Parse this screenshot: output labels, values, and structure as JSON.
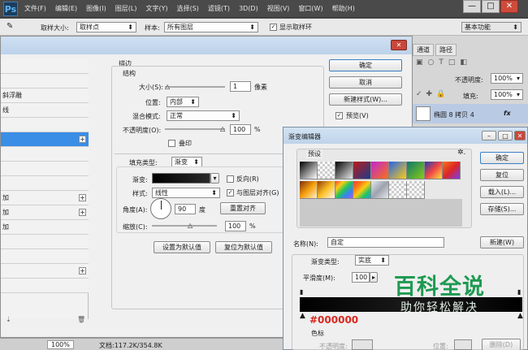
{
  "app": {
    "logo": "Ps"
  },
  "menu": [
    "文件(F)",
    "编辑(E)",
    "图像(I)",
    "图层(L)",
    "文字(Y)",
    "选择(S)",
    "滤镜(T)",
    "3D(D)",
    "视图(V)",
    "窗口(W)",
    "帮助(H)"
  ],
  "window_controls": {
    "minimize": "—",
    "restore": "□",
    "close": "✕"
  },
  "options_bar": {
    "sample_size_label": "取样大小:",
    "sample_size_value": "取样点",
    "sample_label": "样本:",
    "sample_value": "所有图层",
    "show_ring_label": "显示取样环",
    "workspace": "基本功能"
  },
  "layer_style": {
    "title_close": "✕",
    "list_items": [
      "",
      "",
      "斜浮雕",
      "线",
      "",
      "",
      "",
      "",
      "",
      "加",
      "加",
      "加",
      "",
      "",
      "",
      ""
    ],
    "stroke": {
      "section": "描边",
      "structure": "结构",
      "size_label": "大小(S):",
      "size_value": "1",
      "size_unit": "像素",
      "position_label": "位置:",
      "position_value": "内部",
      "blend_label": "混合模式:",
      "blend_value": "正常",
      "opacity_label": "不透明度(O):",
      "opacity_value": "100",
      "opacity_unit": "%",
      "overprint_label": "叠印",
      "fill_type_label": "填充类型:",
      "fill_type_value": "渐变",
      "gradient_label": "渐变:",
      "reverse_label": "反向(R)",
      "style_label": "样式:",
      "style_value": "线性",
      "align_label": "与图层对齐(G)",
      "angle_label": "角度(A):",
      "angle_value": "90",
      "angle_unit": "度",
      "reset_align": "重置对齐",
      "scale_label": "缩放(C):",
      "scale_value": "100",
      "scale_unit": "%",
      "default_set": "设置为默认值",
      "default_reset": "复位为默认值"
    },
    "buttons": {
      "ok": "确定",
      "cancel": "取消",
      "new_style": "新建样式(W)...",
      "preview": "预览(V)"
    }
  },
  "layers_panel": {
    "tabs": [
      "通道",
      "路径"
    ],
    "opacity_label": "不透明度:",
    "opacity_value": "100%",
    "fill_label": "填充:",
    "fill_value": "100%",
    "layer_name": "椭圆 8 拷贝 4",
    "fx": "fx"
  },
  "gradient_editor": {
    "title": "渐变编辑器",
    "presets_label": "预设",
    "buttons": {
      "ok": "确定",
      "reset": "复位",
      "load": "载入(L)...",
      "save": "存储(S)...",
      "new": "新建(W)"
    },
    "name_label": "名称(N):",
    "name_value": "自定",
    "type_label": "渐变类型:",
    "type_value": "实底",
    "smooth_label": "平滑度(M):",
    "smooth_value": "100",
    "color_annotation": "#000000",
    "stops_label": "色标",
    "stop_opacity_label": "不透明度:",
    "stop_location_label": "位置:",
    "delete_label": "删除(D)",
    "presets": [
      "#000000,#ffffff",
      "checker",
      "#000000,transparent",
      "#b91c1c,#1e3a8a",
      "#c026d3,#f97316",
      "#2563eb,#facc15",
      "#0f766e,#84cc16",
      "#1e40af,#ef4444,#fde047",
      "#f97316,#dc2626,#7c3aed",
      "#7c2d12,#f59e0b,#fef3c7",
      "#92400e,#fbbf24,#fff7ed",
      "#ef4444,#facc15,#22c55e,#3b82f6,#a855f7",
      "#ef4444,#f97316,#facc15,#22c55e,#0ea5e9",
      "#e5e7eb,#9ca3af,#e5e7eb",
      "checker",
      "checker"
    ]
  },
  "watermark": {
    "line1": "百科全说",
    "line2": "助你轻松解决"
  },
  "status_bar": {
    "zoom": "100%",
    "doc": "文档:117.2K/354.8K"
  }
}
